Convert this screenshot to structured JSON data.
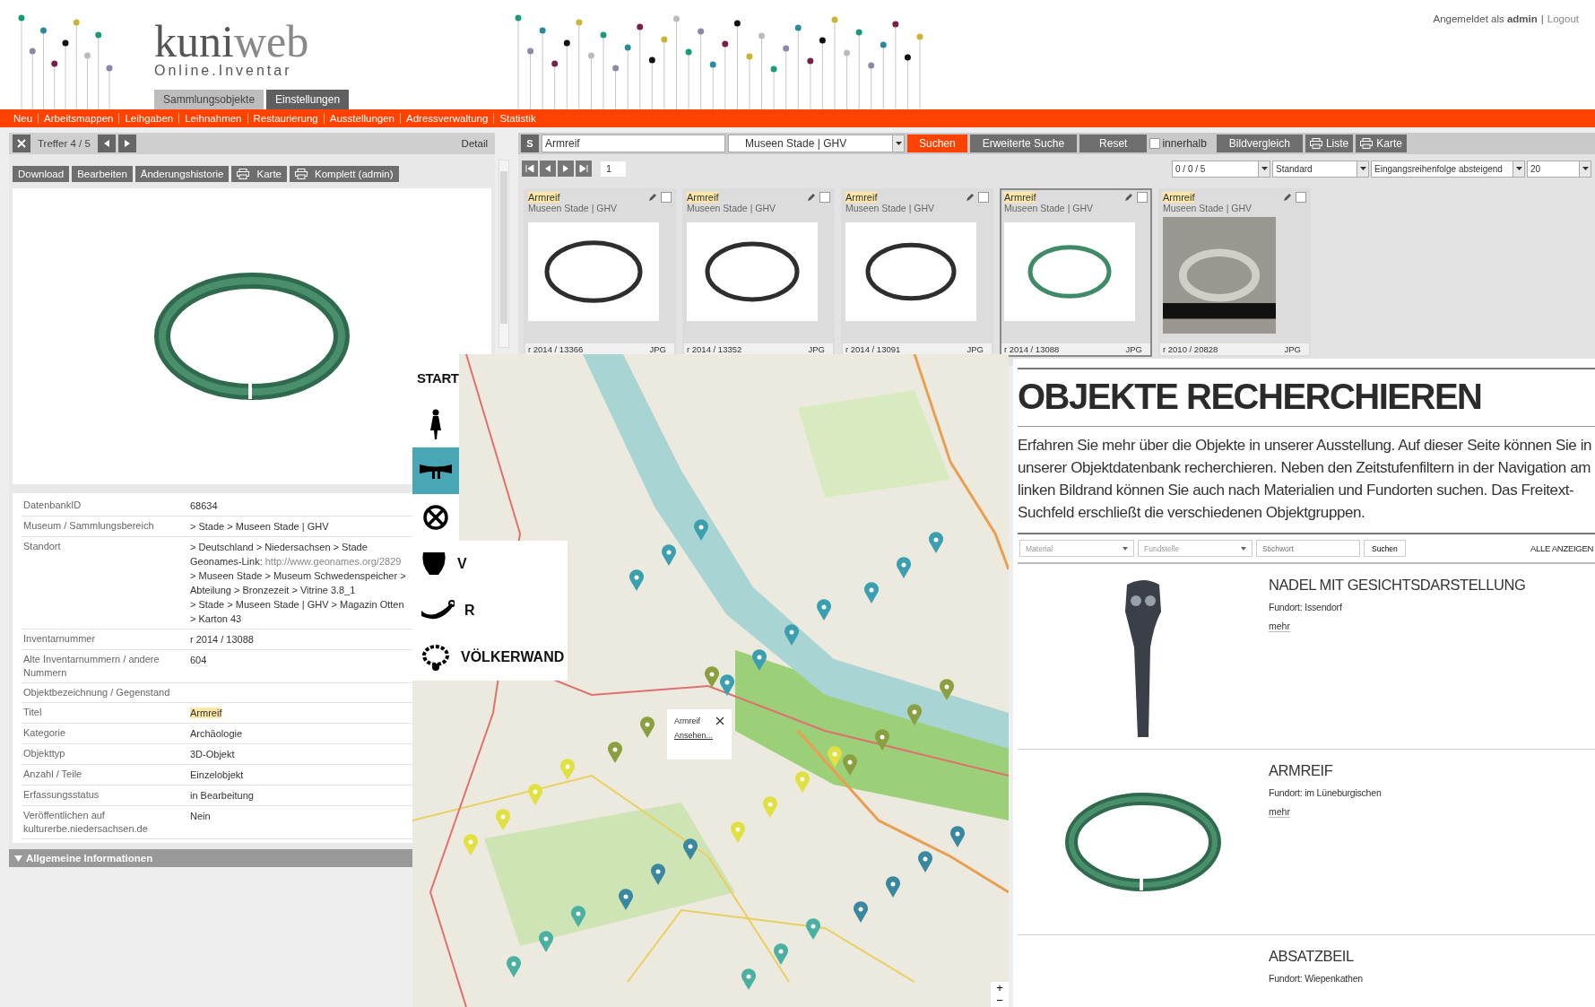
{
  "header": {
    "logo": "kuni",
    "logo_accent": "web",
    "subtitle": "Online.Inventar",
    "user": "Angemeldet als **admin**",
    "separator": "|",
    "logout": "Logout",
    "tabs": [
      {
        "label": "Sammlungsobjekte",
        "selected": true
      },
      {
        "label": "Einstellungen",
        "selected": false
      }
    ]
  },
  "menu": [
    "Neu",
    "Arbeitsmappen",
    "Leihgaben",
    "Leihnahmen",
    "Restaurierung",
    "Ausstellungen",
    "Adressverwaltung",
    "Statistik"
  ],
  "detail": {
    "hits": "Treffer 4 / 5",
    "mode": "Detail",
    "buttons": [
      {
        "label": "Download",
        "has_icon": false
      },
      {
        "label": "Bearbeiten",
        "has_icon": false
      },
      {
        "label": "Änderungshistorie",
        "has_icon": false
      },
      {
        "label": "Karte",
        "has_icon": true
      },
      {
        "label": "Komplett (admin)",
        "has_icon": true
      }
    ],
    "fields": [
      {
        "label": "DatenbankID",
        "values": [
          {
            "text": "68634"
          }
        ]
      },
      {
        "label": "Museum / Sammlungsbereich",
        "values": [
          {
            "text": "> Stade > Museen Stade | GHV"
          }
        ]
      },
      {
        "label": "Standort",
        "values": [
          {
            "text": "> Deutschland > Niedersachsen > Stade"
          },
          {
            "text": "Geonames-Link:",
            "link": "http://www.geonames.org/2829"
          },
          {
            "text": "> Museen Stade > Museum Schwedenspeicher >"
          },
          {
            "text": "Abteilung > Bronzezeit > Vitrine 3.8_1"
          },
          {
            "text": "> Stade > Museen Stade | GHV > Magazin Otten"
          },
          {
            "text": "> Karton 43"
          }
        ]
      },
      {
        "label": "Inventarnummer",
        "values": [
          {
            "text": "r 2014 / 13088"
          }
        ]
      },
      {
        "label": "Alte Inventarnummern / andere Nummern",
        "values": [
          {
            "text": "604"
          }
        ]
      },
      {
        "label": "Objektbezeichnung / Gegenstand"
      },
      {
        "label": "Titel",
        "values": [
          {
            "text": "Armreif",
            "highlight": true
          }
        ]
      },
      {
        "label": "Kategorie",
        "values": [
          {
            "text": "Archäologie"
          }
        ]
      },
      {
        "label": "Objekttyp",
        "values": [
          {
            "text": "3D-Objekt"
          }
        ]
      },
      {
        "label": "Anzahl / Teile",
        "values": [
          {
            "text": "Einzelobjekt"
          }
        ]
      },
      {
        "label": "Erfassungsstatus",
        "values": [
          {
            "text": "in Bearbeitung"
          }
        ]
      },
      {
        "label": "Veröffentlichen auf kulturerbe.niedersachsen.de",
        "values": [
          {
            "text": "Nein"
          }
        ]
      }
    ],
    "section": {
      "label": "Allgemeine Informationen",
      "expanded": true
    }
  },
  "search": {
    "prefix": "S",
    "query": "Armreif",
    "collection": "Museen Stade | GHV",
    "submit": "Suchen",
    "advanced": "Erweiterte Suche",
    "reset": "Reset",
    "within": {
      "label": "innerhalb",
      "checked": false
    },
    "compare": "Bildvergleich",
    "list": "Liste",
    "map": "Karte"
  },
  "pager": {
    "page": "1",
    "count": "0 / 0 / 5",
    "view": "Standard",
    "sort": "Eingangsreihenfolge absteigend",
    "per_page": "20"
  },
  "results": [
    {
      "title": "Armreif",
      "collection": "Museen Stade | GHV",
      "number": "r 2014 / 13366",
      "format": "JPG",
      "selected": false,
      "checked": false
    },
    {
      "title": "Armreif",
      "collection": "Museen Stade | GHV",
      "number": "r 2014 / 13352",
      "format": "JPG",
      "selected": false,
      "checked": false
    },
    {
      "title": "Armreif",
      "collection": "Museen Stade | GHV",
      "number": "r 2014 / 13091",
      "format": "JPG",
      "selected": false,
      "checked": false
    },
    {
      "title": "Armreif",
      "collection": "Museen Stade | GHV",
      "number": "r 2014 / 13088",
      "format": "JPG",
      "selected": true,
      "checked": false
    },
    {
      "title": "Armreif",
      "collection": "Museen Stade | GHV",
      "number": "r 2010 / 20828",
      "format": "JPG",
      "selected": false,
      "checked": false
    }
  ],
  "map_view": {
    "nav": [
      {
        "kind": "text",
        "label": "START",
        "selected": false
      },
      {
        "kind": "icon",
        "selected": false
      },
      {
        "kind": "icon",
        "selected": true
      },
      {
        "kind": "icon",
        "selected": false
      },
      {
        "kind": "icon",
        "label": "V",
        "selected": false
      },
      {
        "kind": "icon",
        "label": "R",
        "selected": false
      },
      {
        "kind": "icon",
        "label": "VÖLKERWAND",
        "selected": false
      }
    ],
    "popup": {
      "title": "Armreif",
      "link": "Ansehen..."
    },
    "zoom_in": "+",
    "zoom_out": "−"
  },
  "research": {
    "title": "OBJEKTE RECHERCHIEREN",
    "intro": "Erfahren Sie mehr über die Objekte in unserer Ausstellung. Auf dieser Seite können Sie in unserer Objektdatenbank recherchieren. Neben den Zeitstufenfiltern in der Navigation am linken Bildrand können Sie auch nach Materialien und Fundorten suchen. Das Freitext-Suchfeld erschließt die verschiedenen Objektgruppen.",
    "filters": {
      "material": "Material",
      "site": "Fundstelle",
      "keyword": {
        "placeholder": "Stichwort"
      },
      "submit": "Suchen",
      "show_all": "ALLE ANZEIGEN"
    },
    "items": [
      {
        "kind": "pin",
        "title": "NADEL MIT GESICHTSDARSTELLUNG",
        "site": "Fundort: Issendorf",
        "more": "mehr"
      },
      {
        "kind": "ring",
        "title": "ARMREIF",
        "site": "Fundort: im Lüneburgischen",
        "more": "mehr"
      },
      {
        "kind": "none",
        "title": "ABSATZBEIL",
        "site": "Fundort: Wiepenkathen"
      }
    ]
  }
}
